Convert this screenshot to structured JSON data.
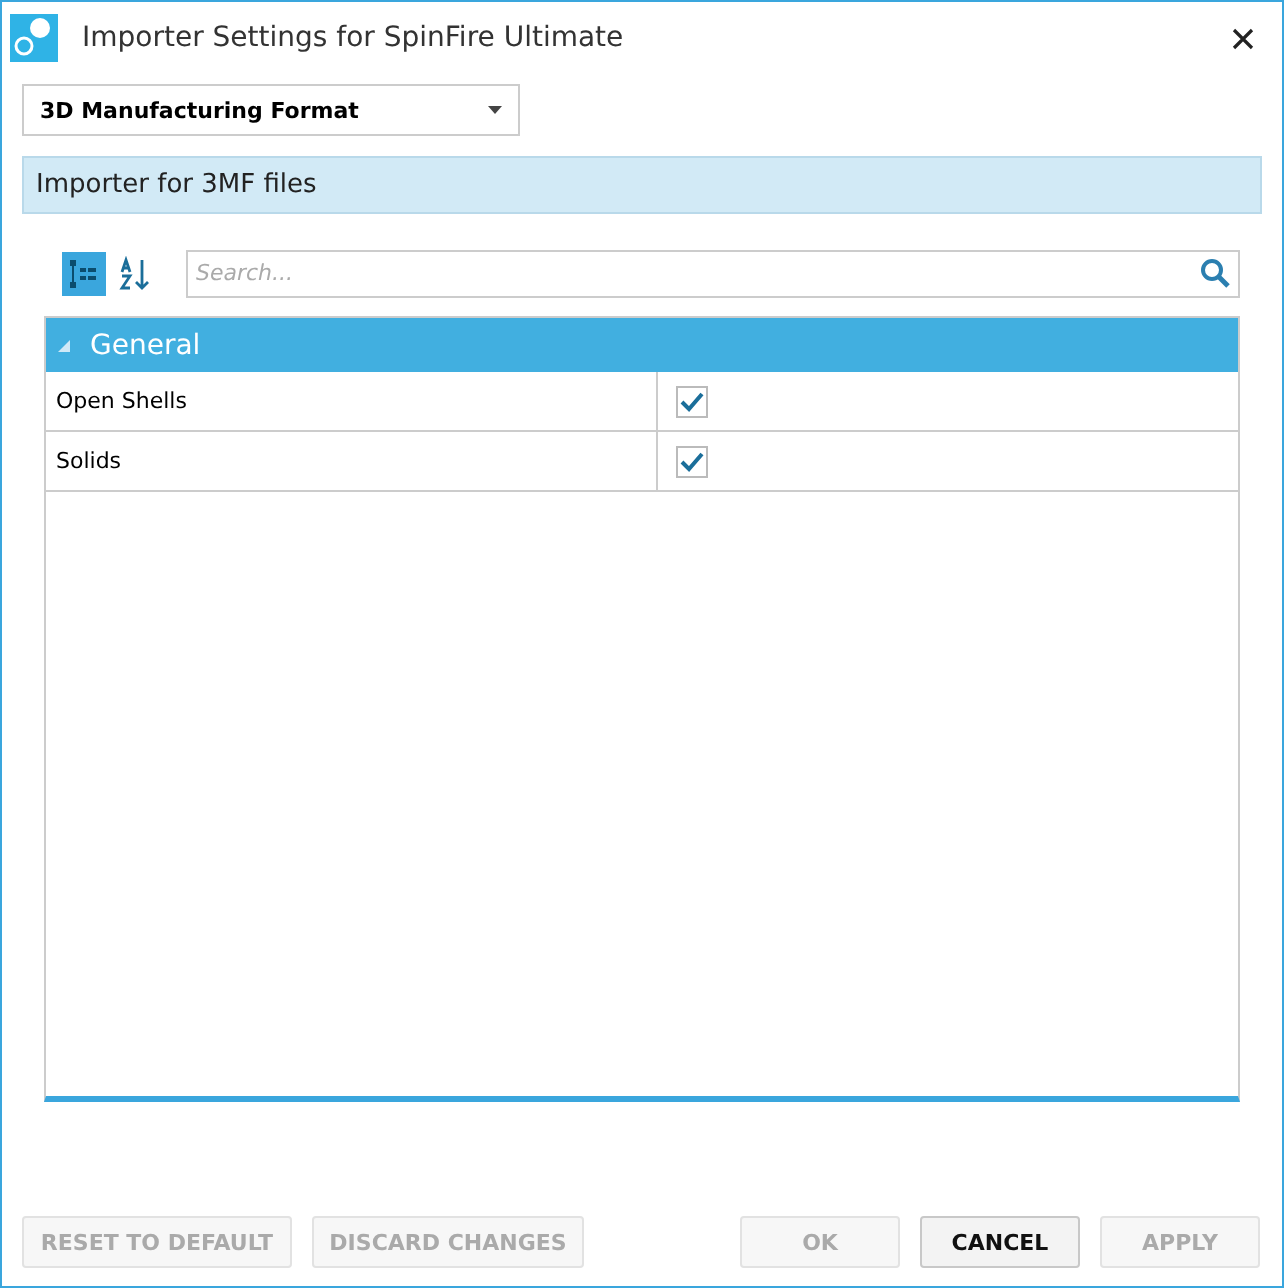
{
  "window": {
    "title": "Importer Settings for SpinFire Ultimate"
  },
  "format_dropdown": {
    "value": "3D Manufacturing Format"
  },
  "description": "Importer for 3MF files",
  "view_buttons": [
    {
      "kind": "categorized",
      "selected": true
    },
    {
      "kind": "alphabetical",
      "selected": false
    }
  ],
  "search": {
    "placeholder": "Search..."
  },
  "groups": [
    {
      "name": "General",
      "expanded": true,
      "properties": [
        {
          "name": "Open Shells",
          "checked": true
        },
        {
          "name": "Solids",
          "checked": true
        }
      ]
    }
  ],
  "buttons": [
    {
      "label": "RESET TO DEFAULT",
      "disabled": true
    },
    {
      "label": "DISCARD CHANGES",
      "disabled": true
    },
    {
      "label": "OK",
      "disabled": true
    },
    {
      "label": "CANCEL",
      "disabled": false
    },
    {
      "label": "APPLY",
      "disabled": true
    }
  ]
}
